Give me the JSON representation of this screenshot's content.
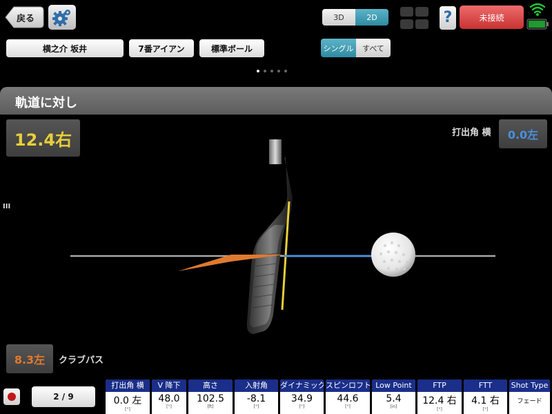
{
  "topbar": {
    "back_label": "戻る",
    "view_3d": "3D",
    "view_2d": "2D",
    "connection": "未接続"
  },
  "selectors": {
    "player": "横之介 坂井",
    "club": "7番アイアン",
    "ball": "標準ボール",
    "mode_single": "シングル",
    "mode_all": "すべて"
  },
  "pager": {
    "count": 5,
    "active": 0
  },
  "panel": {
    "title": "軌道に対し",
    "face_angle": "12.4右",
    "launch_h_label": "打出角 横",
    "launch_h_value": "0.0左",
    "club_path_value": "8.3左",
    "club_path_label": "クラブパス",
    "side_handle": "III"
  },
  "colors": {
    "face_value": "#e8cf3a",
    "launch_value": "#4a8fe0",
    "path_value": "#e07a30",
    "header_blue": "#1a2e8a",
    "connect_red": "#d94444"
  },
  "bottom": {
    "shot_counter": "2 / 9",
    "metrics": [
      {
        "label": "打出角 横",
        "value": "0.0 左",
        "unit": "[°]"
      },
      {
        "label": "V 降下",
        "value": "48.0",
        "unit": "[°]"
      },
      {
        "label": "高さ",
        "value": "102.5",
        "unit": "[ft]"
      },
      {
        "label": "入射角",
        "value": "-8.1",
        "unit": "[°]"
      },
      {
        "label": "ダイナミックL",
        "value": "34.9",
        "unit": "[°]"
      },
      {
        "label": "スピンロフト",
        "value": "44.6",
        "unit": "[°]"
      },
      {
        "label": "Low Point",
        "value": "5.4",
        "unit": "[in]"
      },
      {
        "label": "FTP",
        "value": "12.4 右",
        "unit": "[°]"
      },
      {
        "label": "FTT",
        "value": "4.1 右",
        "unit": "[°]"
      },
      {
        "label": "Shot Type",
        "value": "フェード",
        "unit": ""
      }
    ]
  }
}
